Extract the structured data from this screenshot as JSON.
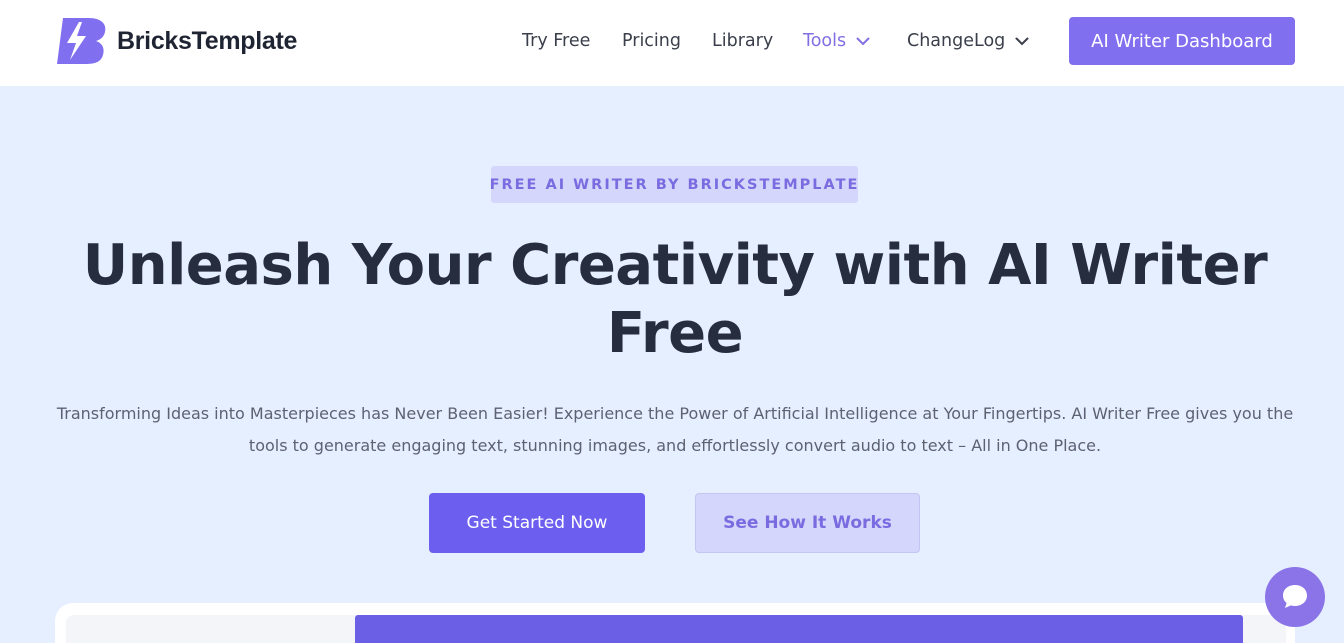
{
  "brand": {
    "name": "BricksTemplate",
    "logo_icon": "bolt-b-logo-icon",
    "accent": "#8070f0"
  },
  "nav": {
    "items": [
      {
        "label": "Try Free"
      },
      {
        "label": "Pricing"
      },
      {
        "label": "Library"
      },
      {
        "label": "Tools",
        "has_dropdown": true,
        "active": true
      },
      {
        "label": "ChangeLog",
        "has_dropdown": true
      }
    ],
    "cta_label": "AI Writer Dashboard"
  },
  "hero": {
    "eyebrow": "FREE AI WRITER BY BRICKSTEMPLATE",
    "title_line1": "Unleash Your Creativity with AI Writer",
    "title_line2": "Free",
    "subtitle_line1": "Transforming Ideas into Masterpieces has Never Been Easier! Experience the Power of Artificial Intelligence at Your Fingertips. AI Writer Free gives you the",
    "subtitle_line2": "tools to generate engaging text, stunning images, and effortlessly convert audio to text – All in One Place.",
    "primary_button": "Get Started Now",
    "secondary_button": "See How It Works"
  },
  "chat_widget": {
    "icon": "chat-bubble-icon"
  }
}
